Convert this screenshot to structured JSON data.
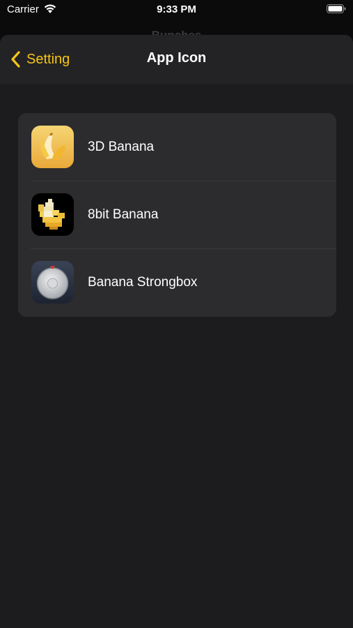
{
  "status_bar": {
    "carrier": "Carrier",
    "time": "9:33 PM"
  },
  "background_title": "Bunches",
  "navbar": {
    "back_label": "Setting",
    "title": "App Icon"
  },
  "colors": {
    "accent": "#f5c518",
    "sheet": "#1c1c1e",
    "card": "#2c2c2e"
  },
  "icons": [
    {
      "name": "3D Banana",
      "icon": "banana-3d-icon"
    },
    {
      "name": "8bit Banana",
      "icon": "banana-8bit-icon"
    },
    {
      "name": "Banana Strongbox",
      "icon": "strongbox-icon"
    }
  ]
}
